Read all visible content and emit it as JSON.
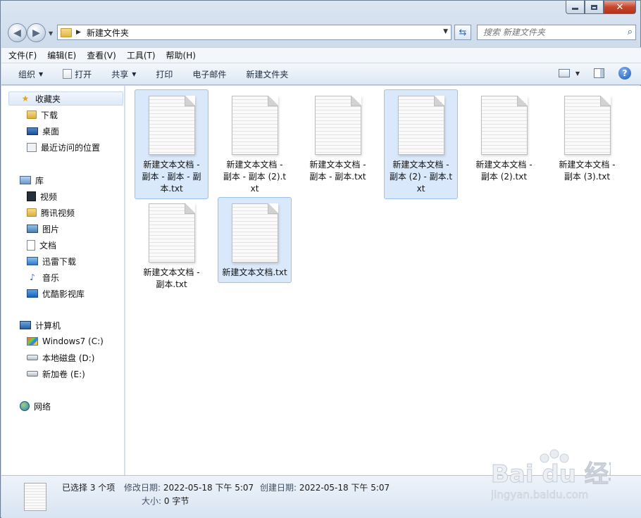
{
  "address": {
    "crumb": "新建文件夹"
  },
  "search": {
    "placeholder": "搜索 新建文件夹"
  },
  "menu": [
    "文件(F)",
    "编辑(E)",
    "查看(V)",
    "工具(T)",
    "帮助(H)"
  ],
  "toolbar": {
    "organize": "组织",
    "open": "打开",
    "share": "共享",
    "print": "打印",
    "email": "电子邮件",
    "new_folder": "新建文件夹"
  },
  "nav": {
    "favorites": {
      "label": "收藏夹",
      "items": [
        "下载",
        "桌面",
        "最近访问的位置"
      ]
    },
    "libraries": {
      "label": "库",
      "items": [
        "视频",
        "腾讯视频",
        "图片",
        "文档",
        "迅雷下载",
        "音乐",
        "优酷影视库"
      ]
    },
    "computer": {
      "label": "计算机",
      "items": [
        "Windows7 (C:)",
        "本地磁盘 (D:)",
        "新加卷 (E:)"
      ]
    },
    "network": {
      "label": "网络"
    }
  },
  "files": [
    {
      "name": "新建文本文档 - 副本 - 副本 - 副本.txt",
      "selected": true
    },
    {
      "name": "新建文本文档 - 副本 - 副本 (2).txt",
      "selected": false
    },
    {
      "name": "新建文本文档 - 副本 - 副本.txt",
      "selected": false
    },
    {
      "name": "新建文本文档 - 副本 (2) - 副本.txt",
      "selected": true
    },
    {
      "name": "新建文本文档 - 副本 (2).txt",
      "selected": false
    },
    {
      "name": "新建文本文档 - 副本 (3).txt",
      "selected": false
    },
    {
      "name": "新建文本文档 - 副本.txt",
      "selected": false
    },
    {
      "name": "新建文本文档.txt",
      "selected": true
    }
  ],
  "status": {
    "selected": "已选择 3 个项",
    "modified_label": "修改日期:",
    "modified_value": "2022-05-18 下午 5:07",
    "created_label": "创建日期:",
    "created_value": "2022-05-18 下午 5:07",
    "size_label": "大小:",
    "size_value": "0 字节"
  },
  "watermark": {
    "brand": "Bai du 经验",
    "url": "jingyan.baidu.com"
  },
  "colors": {
    "selection": "#d9e8fa",
    "selection_border": "#9cc1ea",
    "accent": "#1e5bb7"
  }
}
